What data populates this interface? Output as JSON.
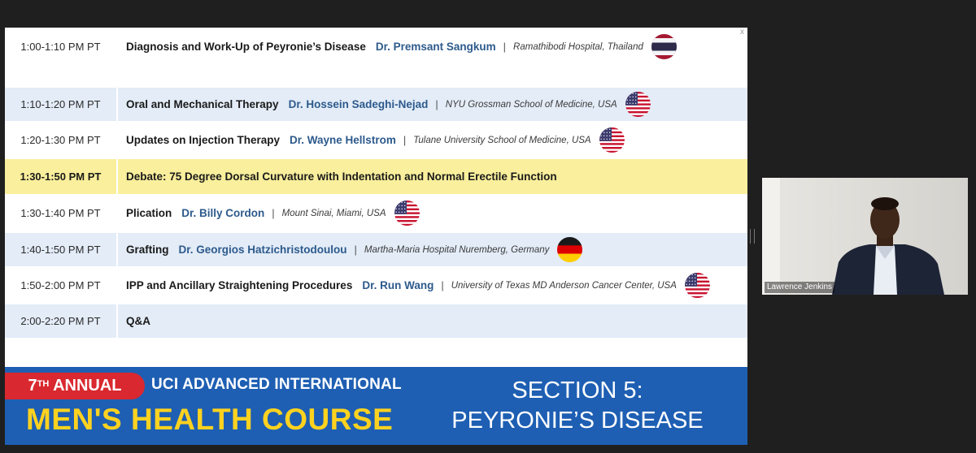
{
  "schedule": [
    {
      "time": "1:00-1:10 PM PT",
      "title": "Diagnosis and Work-Up of Peyronie’s Disease",
      "speaker": "Dr. Premsant Sangkum",
      "institution": "Ramathibodi Hospital, Thailand",
      "flag": "thailand-flag-icon",
      "style": "plain"
    },
    {
      "time": "1:10-1:20 PM PT",
      "title": "Oral and Mechanical Therapy",
      "speaker": "Dr. Hossein Sadeghi-Nejad",
      "institution": "NYU Grossman School of Medicine, USA",
      "flag": "usa-flag-icon",
      "style": "shaded"
    },
    {
      "time": "1:20-1:30 PM PT",
      "title": "Updates on Injection Therapy",
      "speaker": "Dr. Wayne Hellstrom",
      "institution": "Tulane University School of Medicine, USA",
      "flag": "usa-flag-icon",
      "style": "plain"
    },
    {
      "time": "1:30-1:50 PM PT",
      "title": "Debate: 75 Degree Dorsal Curvature with Indentation and Normal Erectile Function",
      "speaker": "",
      "institution": "",
      "flag": "",
      "style": "highlight"
    },
    {
      "time": "1:30-1:40 PM PT",
      "title": "Plication",
      "speaker": "Dr. Billy Cordon",
      "institution": "Mount Sinai, Miami, USA",
      "flag": "usa-flag-icon",
      "style": "plain"
    },
    {
      "time": "1:40-1:50 PM PT",
      "title": "Grafting",
      "speaker": "Dr. Georgios Hatzichristodoulou",
      "institution": "Martha-Maria Hospital Nuremberg, Germany",
      "flag": "germany-flag-icon",
      "style": "shaded"
    },
    {
      "time": "1:50-2:00 PM PT",
      "title": "IPP and Ancillary Straightening Procedures",
      "speaker": "Dr. Run Wang",
      "institution": "University of Texas MD Anderson Cancer Center, USA",
      "flag": "usa-flag-icon",
      "style": "plain"
    },
    {
      "time": "2:00-2:20 PM PT",
      "title": "Q&A",
      "speaker": "",
      "institution": "",
      "flag": "",
      "style": "shaded"
    }
  ],
  "banner": {
    "annual_number": "7",
    "annual_suffix": "TH",
    "annual_word": " ANNUAL",
    "uci_line": "UCI ADVANCED INTERNATIONAL",
    "course_line": "MEN'S HEALTH COURSE",
    "section_line1": "SECTION 5:",
    "section_line2": "PEYRONIE’S DISEASE"
  },
  "video": {
    "participant_name": "Lawrence Jenkins"
  },
  "slide": {
    "close_glyph": "x"
  },
  "colors": {
    "speaker": "#2d5a8c",
    "banner": "#1e5fb3",
    "course": "#ffd21f",
    "pill": "#d9282f",
    "shaded": "#e3ecf7",
    "highlight": "#f9ef9c"
  }
}
